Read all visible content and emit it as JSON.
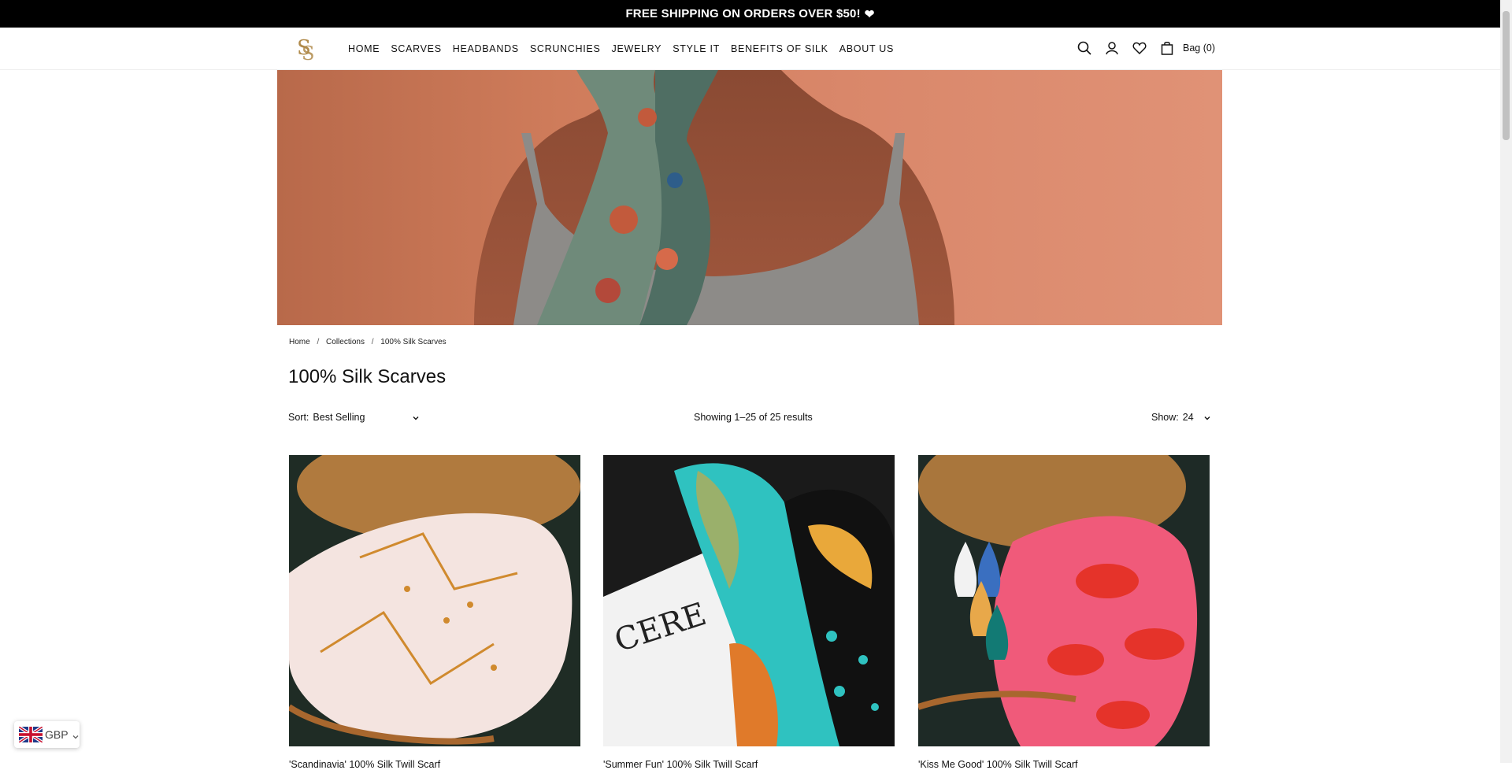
{
  "announcement": {
    "text": "FREE SHIPPING ON ORDERS OVER $50!",
    "icon": "heart-icon"
  },
  "brand": {
    "logo_letters": "SS",
    "logo_color": "#b08a4a"
  },
  "nav": {
    "items": [
      "HOME",
      "SCARVES",
      "HEADBANDS",
      "SCRUNCHIES",
      "JEWELRY",
      "STYLE IT",
      "BENEFITS OF SILK",
      "ABOUT US"
    ]
  },
  "header_icons": {
    "search": "search-icon",
    "account": "user-icon",
    "wishlist": "heart-icon",
    "bag": "bag-icon"
  },
  "bag": {
    "label": "Bag (0)"
  },
  "hero": {
    "description_icon": "hero-banner-image"
  },
  "breadcrumb": {
    "home": "Home",
    "collections": "Collections",
    "current": "100% Silk Scarves",
    "separator": "/"
  },
  "page": {
    "title": "100% Silk Scarves"
  },
  "toolbar": {
    "sort_label": "Sort:",
    "sort_value": "Best Selling",
    "results_text": "Showing 1–25 of 25 results",
    "show_label": "Show:",
    "show_value": "24"
  },
  "products": [
    {
      "title": "'Scandinavia' 100% Silk Twill Scarf"
    },
    {
      "title": "'Summer Fun' 100% Silk Twill Scarf"
    },
    {
      "title": "'Kiss Me Good' 100% Silk Twill Scarf"
    }
  ],
  "currency": {
    "code": "GBP",
    "flag": "uk-flag-icon"
  },
  "colors": {
    "announcement_bg": "#000000",
    "accent_gold": "#b08a4a",
    "hero_bg": "#d9876a"
  }
}
